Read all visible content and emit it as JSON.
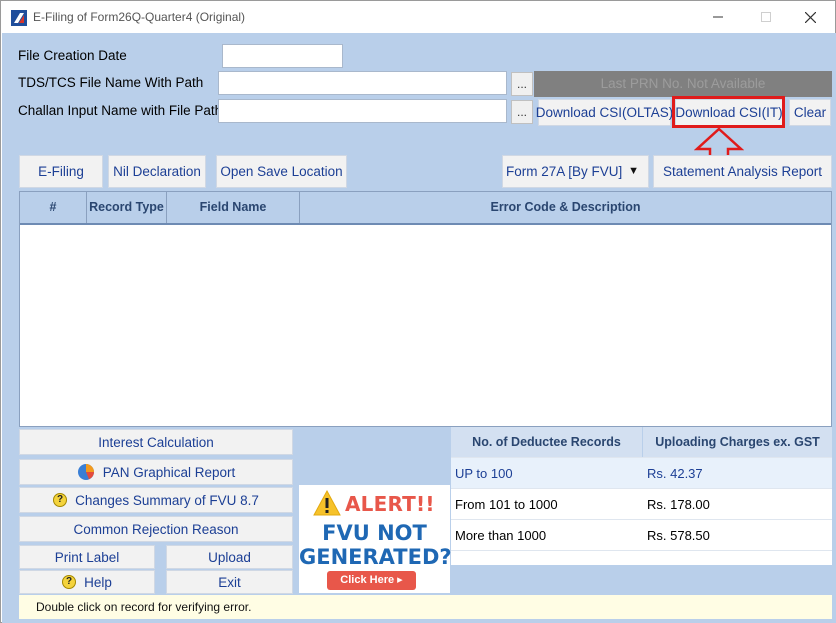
{
  "window": {
    "title": "E-Filing of Form26Q-Quarter4 (Original)",
    "minimize_icon": "minimize-icon",
    "maximize_icon": "maximize-icon",
    "close_icon": "close-icon"
  },
  "fields": {
    "file_creation_date_label": "File Creation Date",
    "file_creation_date_value": "",
    "tds_file_label": "TDS/TCS File Name With Path",
    "tds_file_value": "",
    "challan_label": "Challan Input Name with File Path",
    "challan_value": "",
    "browse_label": "..."
  },
  "prn_status": "Last PRN No. Not Available",
  "top_buttons": {
    "download_oltas": "Download CSI(OLTAS)",
    "download_it": "Download CSI(IT)",
    "clear": "Clear"
  },
  "toolbar": {
    "efiling": "E-Filing",
    "nil_declaration": "Nil Declaration",
    "open_save_location": "Open Save Location",
    "form_select": "Form 27A [By FVU]",
    "statement_analysis": "Statement Analysis Report"
  },
  "grid": {
    "columns": [
      "#",
      "Record Type",
      "Field Name",
      "Error Code & Description"
    ],
    "rows": []
  },
  "actions": {
    "interest_calculation": "Interest Calculation",
    "pan_graphical_report": "PAN Graphical Report",
    "changes_summary": "Changes Summary of FVU 8.7",
    "common_rejection": "Common Rejection Reason",
    "print_label": "Print Label",
    "upload": "Upload",
    "help": "Help",
    "exit": "Exit"
  },
  "alert": {
    "title": "ALERT!!",
    "line1": "FVU NOT",
    "line2": "GENERATED?",
    "button": "Click Here ▸"
  },
  "charges": {
    "headers": [
      "No. of Deductee Records",
      "Uploading Charges ex. GST"
    ],
    "rows": [
      {
        "range": "UP to 100",
        "charge": "Rs. 42.37"
      },
      {
        "range": "From 101 to 1000",
        "charge": "Rs. 178.00"
      },
      {
        "range": "More than 1000",
        "charge": "Rs. 578.50"
      }
    ]
  },
  "status_message": "Double click on record for verifying error.",
  "colors": {
    "client_bg": "#b9cfea",
    "button_text": "#1c3f95",
    "highlight": "#e01b1b",
    "alert_red": "#e8574a",
    "alert_blue": "#1f68b4"
  }
}
